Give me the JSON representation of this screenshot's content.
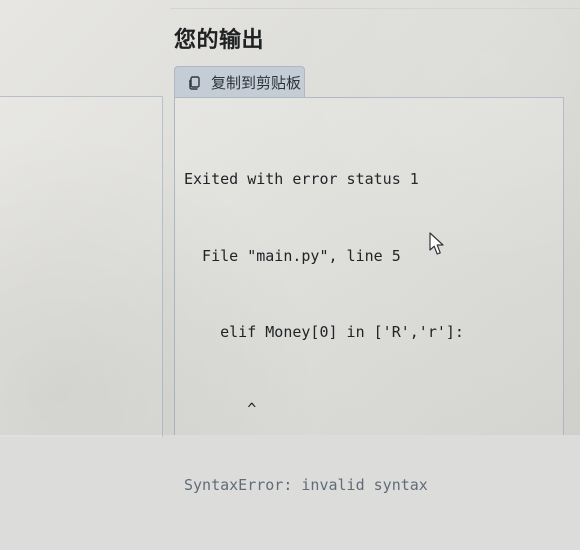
{
  "page": {
    "title": "您的输出"
  },
  "actions": {
    "copy_label": "复制到剪贴板",
    "copy_icon": "copy-icon"
  },
  "output": {
    "lines": [
      "Exited with error status 1",
      "  File \"main.py\", line 5",
      "    elif Money[0] in ['R','r']:",
      "       ^",
      "SyntaxError: invalid syntax"
    ]
  },
  "pointer": {
    "icon": "mouse-pointer-icon"
  },
  "colors": {
    "button_bg": "#c4ccd6",
    "panel_border": "#aeb8c3",
    "text": "#202426",
    "error_text": "#616c79"
  }
}
